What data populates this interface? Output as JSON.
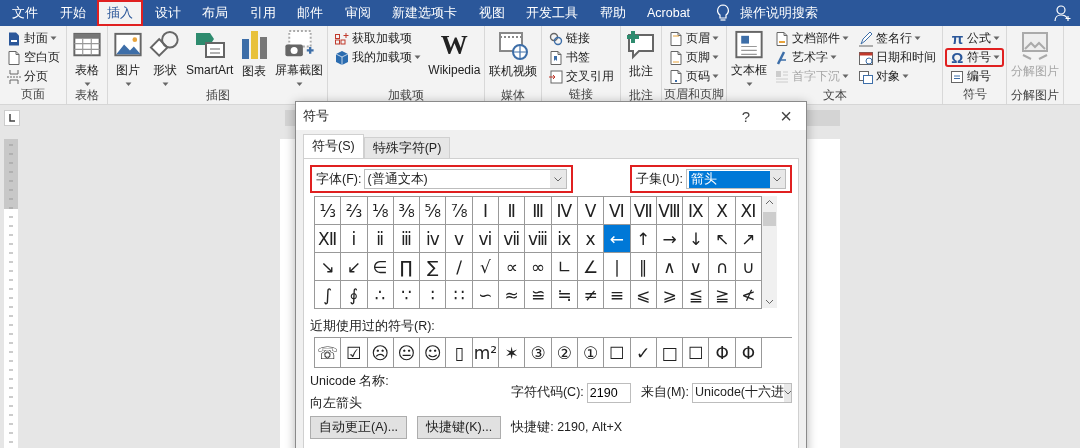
{
  "tabs": [
    {
      "label": "文件",
      "selected": false,
      "highlighted": false
    },
    {
      "label": "开始",
      "selected": false,
      "highlighted": false
    },
    {
      "label": "插入",
      "selected": true,
      "highlighted": true
    },
    {
      "label": "设计",
      "selected": false,
      "highlighted": false
    },
    {
      "label": "布局",
      "selected": false,
      "highlighted": false
    },
    {
      "label": "引用",
      "selected": false,
      "highlighted": false
    },
    {
      "label": "邮件",
      "selected": false,
      "highlighted": false
    },
    {
      "label": "审阅",
      "selected": false,
      "highlighted": false
    },
    {
      "label": "新建选项卡",
      "selected": false,
      "highlighted": false
    },
    {
      "label": "视图",
      "selected": false,
      "highlighted": false
    },
    {
      "label": "开发工具",
      "selected": false,
      "highlighted": false
    },
    {
      "label": "帮助",
      "selected": false,
      "highlighted": false
    },
    {
      "label": "Acrobat",
      "selected": false,
      "highlighted": false
    }
  ],
  "search": {
    "label": "操作说明搜索"
  },
  "ribbon": {
    "groups": [
      {
        "label": "页面",
        "columns": [
          [
            {
              "kind": "small",
              "label": "封面",
              "caret": true,
              "disabled": false,
              "highlighted": false
            },
            {
              "kind": "small",
              "label": "空白页",
              "caret": false,
              "disabled": false,
              "highlighted": false
            },
            {
              "kind": "small",
              "label": "分页",
              "caret": false,
              "disabled": false,
              "highlighted": false
            }
          ]
        ]
      },
      {
        "label": "表格",
        "columns": [
          [
            {
              "kind": "large",
              "label": "表格",
              "caret": true,
              "disabled": false,
              "highlighted": false
            }
          ]
        ]
      },
      {
        "label": "插图",
        "columns": [
          [
            {
              "kind": "large",
              "label": "图片",
              "caret": true,
              "disabled": false,
              "highlighted": false
            }
          ],
          [
            {
              "kind": "large",
              "label": "形状",
              "caret": true,
              "disabled": false,
              "highlighted": false
            }
          ],
          [
            {
              "kind": "large",
              "label": "SmartArt",
              "caret": false,
              "disabled": false,
              "highlighted": false
            }
          ],
          [
            {
              "kind": "large",
              "label": "图表",
              "caret": false,
              "disabled": false,
              "highlighted": false
            }
          ],
          [
            {
              "kind": "large",
              "label": "屏幕截图",
              "caret": true,
              "disabled": false,
              "highlighted": false
            }
          ]
        ]
      },
      {
        "label": "加载项",
        "columns": [
          [
            {
              "kind": "small",
              "label": "获取加载项",
              "caret": false,
              "disabled": false,
              "highlighted": false
            },
            {
              "kind": "small",
              "label": "我的加载项",
              "caret": true,
              "disabled": false,
              "highlighted": false
            }
          ],
          [
            {
              "kind": "large",
              "label": "Wikipedia",
              "logo": "W",
              "caret": false,
              "disabled": false,
              "highlighted": false
            }
          ]
        ]
      },
      {
        "label": "媒体",
        "columns": [
          [
            {
              "kind": "large",
              "label": "联机视频",
              "caret": false,
              "disabled": false,
              "highlighted": false
            }
          ]
        ]
      },
      {
        "label": "链接",
        "columns": [
          [
            {
              "kind": "small",
              "label": "链接",
              "caret": false,
              "disabled": false,
              "highlighted": false
            },
            {
              "kind": "small",
              "label": "书签",
              "caret": false,
              "disabled": false,
              "highlighted": false
            },
            {
              "kind": "small",
              "label": "交叉引用",
              "caret": false,
              "disabled": false,
              "highlighted": false
            }
          ]
        ]
      },
      {
        "label": "批注",
        "columns": [
          [
            {
              "kind": "large",
              "label": "批注",
              "caret": false,
              "disabled": false,
              "highlighted": false
            }
          ]
        ]
      },
      {
        "label": "页眉和页脚",
        "columns": [
          [
            {
              "kind": "small",
              "label": "页眉",
              "caret": true,
              "disabled": false,
              "highlighted": false
            },
            {
              "kind": "small",
              "label": "页脚",
              "caret": true,
              "disabled": false,
              "highlighted": false
            },
            {
              "kind": "small",
              "label": "页码",
              "caret": true,
              "disabled": false,
              "highlighted": false
            }
          ]
        ]
      },
      {
        "label": "文本",
        "columns": [
          [
            {
              "kind": "large",
              "label": "文本框",
              "caret": true,
              "disabled": false,
              "highlighted": false
            }
          ],
          [
            {
              "kind": "small",
              "label": "文档部件",
              "caret": true,
              "disabled": false,
              "highlighted": false
            },
            {
              "kind": "small",
              "label": "艺术字",
              "caret": true,
              "disabled": false,
              "highlighted": false
            },
            {
              "kind": "small",
              "label": "首字下沉",
              "caret": true,
              "disabled": true,
              "highlighted": false
            }
          ],
          [
            {
              "kind": "small",
              "label": "签名行",
              "caret": true,
              "disabled": false,
              "highlighted": false
            },
            {
              "kind": "small",
              "label": "日期和时间",
              "caret": false,
              "disabled": false,
              "highlighted": false
            },
            {
              "kind": "small",
              "label": "对象",
              "caret": true,
              "disabled": false,
              "highlighted": false
            }
          ]
        ]
      },
      {
        "label": "符号",
        "columns": [
          [
            {
              "kind": "small",
              "label": "公式",
              "glyph": "π",
              "caret": true,
              "disabled": false,
              "highlighted": false
            },
            {
              "kind": "small",
              "label": "符号",
              "glyph": "Ω",
              "caret": true,
              "disabled": false,
              "highlighted": true
            },
            {
              "kind": "small",
              "label": "编号",
              "caret": false,
              "disabled": false,
              "highlighted": false
            }
          ]
        ]
      },
      {
        "label": "分解图片",
        "columns": [
          [
            {
              "kind": "large",
              "label": "分解图片",
              "caret": false,
              "disabled": true,
              "highlighted": false
            }
          ]
        ]
      }
    ]
  },
  "dialog": {
    "title": "符号",
    "help": "?",
    "close": "×",
    "tabs": [
      {
        "label": "符号(S)",
        "selected": true
      },
      {
        "label": "特殊字符(P)",
        "selected": false
      }
    ],
    "font": {
      "label": "字体(F):",
      "value": "(普通文本)",
      "highlighted": true
    },
    "subset": {
      "label": "子集(U):",
      "value": "箭头",
      "highlighted": true
    },
    "symbols": [
      [
        {
          "char": "⅓",
          "selected": false
        },
        {
          "char": "⅔",
          "selected": false
        },
        {
          "char": "⅛",
          "selected": false
        },
        {
          "char": "⅜",
          "selected": false
        },
        {
          "char": "⅝",
          "selected": false
        },
        {
          "char": "⅞",
          "selected": false
        },
        {
          "char": "Ⅰ",
          "selected": false
        },
        {
          "char": "Ⅱ",
          "selected": false
        },
        {
          "char": "Ⅲ",
          "selected": false
        },
        {
          "char": "Ⅳ",
          "selected": false
        },
        {
          "char": "Ⅴ",
          "selected": false
        },
        {
          "char": "Ⅵ",
          "selected": false
        },
        {
          "char": "Ⅶ",
          "selected": false
        },
        {
          "char": "Ⅷ",
          "selected": false
        },
        {
          "char": "Ⅸ",
          "selected": false
        },
        {
          "char": "Ⅹ",
          "selected": false
        },
        {
          "char": "Ⅺ",
          "selected": false
        }
      ],
      [
        {
          "char": "Ⅻ",
          "selected": false
        },
        {
          "char": "ⅰ",
          "selected": false
        },
        {
          "char": "ⅱ",
          "selected": false
        },
        {
          "char": "ⅲ",
          "selected": false
        },
        {
          "char": "ⅳ",
          "selected": false
        },
        {
          "char": "ⅴ",
          "selected": false
        },
        {
          "char": "ⅵ",
          "selected": false
        },
        {
          "char": "ⅶ",
          "selected": false
        },
        {
          "char": "ⅷ",
          "selected": false
        },
        {
          "char": "ⅸ",
          "selected": false
        },
        {
          "char": "ⅹ",
          "selected": false
        },
        {
          "char": "←",
          "selected": true
        },
        {
          "char": "↑",
          "selected": false
        },
        {
          "char": "→",
          "selected": false
        },
        {
          "char": "↓",
          "selected": false
        },
        {
          "char": "↖",
          "selected": false
        },
        {
          "char": "↗",
          "selected": false
        }
      ],
      [
        {
          "char": "↘",
          "selected": false
        },
        {
          "char": "↙",
          "selected": false
        },
        {
          "char": "∈",
          "selected": false
        },
        {
          "char": "∏",
          "selected": false
        },
        {
          "char": "∑",
          "selected": false
        },
        {
          "char": "∕",
          "selected": false
        },
        {
          "char": "√",
          "selected": false
        },
        {
          "char": "∝",
          "selected": false
        },
        {
          "char": "∞",
          "selected": false
        },
        {
          "char": "∟",
          "selected": false
        },
        {
          "char": "∠",
          "selected": false
        },
        {
          "char": "∣",
          "selected": false
        },
        {
          "char": "∥",
          "selected": false
        },
        {
          "char": "∧",
          "selected": false
        },
        {
          "char": "∨",
          "selected": false
        },
        {
          "char": "∩",
          "selected": false
        },
        {
          "char": "∪",
          "selected": false
        }
      ],
      [
        {
          "char": "∫",
          "selected": false
        },
        {
          "char": "∮",
          "selected": false
        },
        {
          "char": "∴",
          "selected": false
        },
        {
          "char": "∵",
          "selected": false
        },
        {
          "char": "∶",
          "selected": false
        },
        {
          "char": "∷",
          "selected": false
        },
        {
          "char": "∽",
          "selected": false
        },
        {
          "char": "≈",
          "selected": false
        },
        {
          "char": "≌",
          "selected": false
        },
        {
          "char": "≒",
          "selected": false
        },
        {
          "char": "≠",
          "selected": false
        },
        {
          "char": "≡",
          "selected": false
        },
        {
          "char": "⩽",
          "selected": false
        },
        {
          "char": "⩾",
          "selected": false
        },
        {
          "char": "≦",
          "selected": false
        },
        {
          "char": "≧",
          "selected": false
        },
        {
          "char": "≮",
          "selected": false
        }
      ]
    ],
    "recent_label": "近期使用过的符号(R):",
    "recent": [
      "☏",
      "☑",
      "☹",
      "😐",
      "☺",
      "▯",
      "m²",
      "✶",
      "③",
      "②",
      "①",
      "☐",
      "✓",
      "□",
      "☐",
      "Φ",
      "Φ"
    ],
    "unicode_name_label": "Unicode 名称:",
    "unicode_name": "向左箭头",
    "char_code": {
      "label": "字符代码(C):",
      "value": "2190"
    },
    "from": {
      "label": "来自(M):",
      "value": "Unicode(十六进"
    },
    "buttons": [
      "自动更正(A)...",
      "快捷键(K)..."
    ],
    "shortcut": "快捷键: 2190, Alt+X"
  }
}
